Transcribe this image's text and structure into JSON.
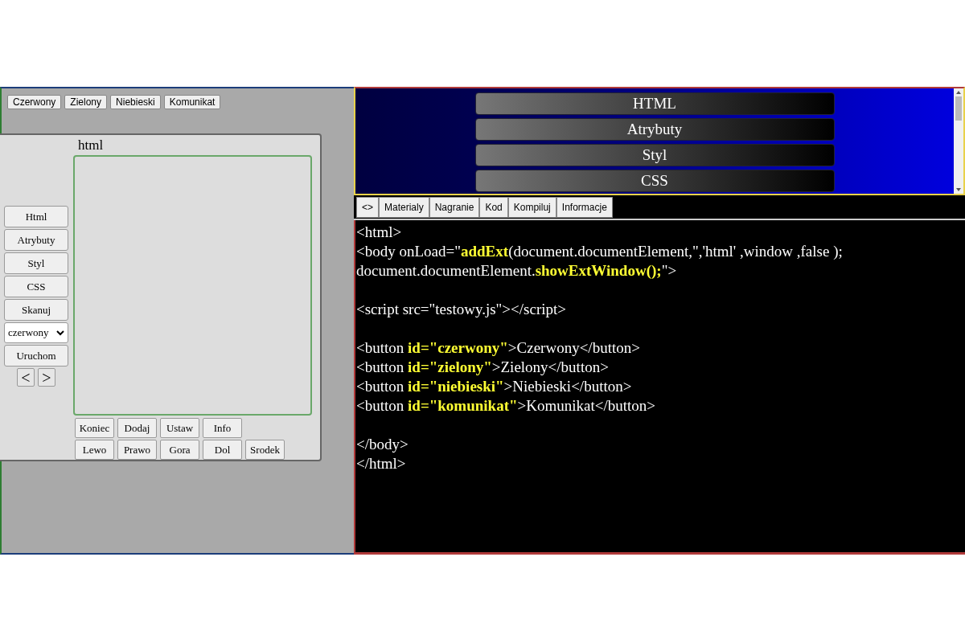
{
  "left_panel": {
    "top_buttons": [
      "Czerwony",
      "Zielony",
      "Niebieski",
      "Komunikat"
    ],
    "dialog": {
      "title": "html",
      "side_buttons": [
        "Html",
        "Atrybuty",
        "Styl",
        "CSS",
        "Skanuj"
      ],
      "select": {
        "value": "czerwony"
      },
      "run_button": "Uruchom",
      "nav_buttons": [
        "<",
        ">"
      ],
      "bottom_rows": [
        [
          "Koniec",
          "Dodaj",
          "Ustaw",
          "Info"
        ],
        [
          "Lewo",
          "Prawo",
          "Gora",
          "Dol",
          "Srodek"
        ]
      ]
    }
  },
  "right_panel": {
    "menu": [
      "HTML",
      "Atrybuty",
      "Styl",
      "CSS"
    ],
    "tabs": [
      "<>",
      "Materialy",
      "Nagranie",
      "Kod",
      "Kompiluj",
      "Informacje"
    ],
    "code_blocks": [
      [
        "<html>",
        "<body onLoad=\"**addExt**(document.documentElement,\",'html' ,window ,false );",
        "document.documentElement.**showExtWindow();**\">"
      ],
      [
        "<script src=\"testowy.js\"></script>"
      ],
      [
        "<button **id=\"czerwony\"**>Czerwony</button>",
        "<button **id=\"zielony\"**>Zielony</button>",
        "<button **id=\"niebieski\"**>Niebieski</button>",
        "<button **id=\"komunikat\"**>Komunikat</button>"
      ],
      [
        "</body>",
        "</html>"
      ]
    ]
  }
}
